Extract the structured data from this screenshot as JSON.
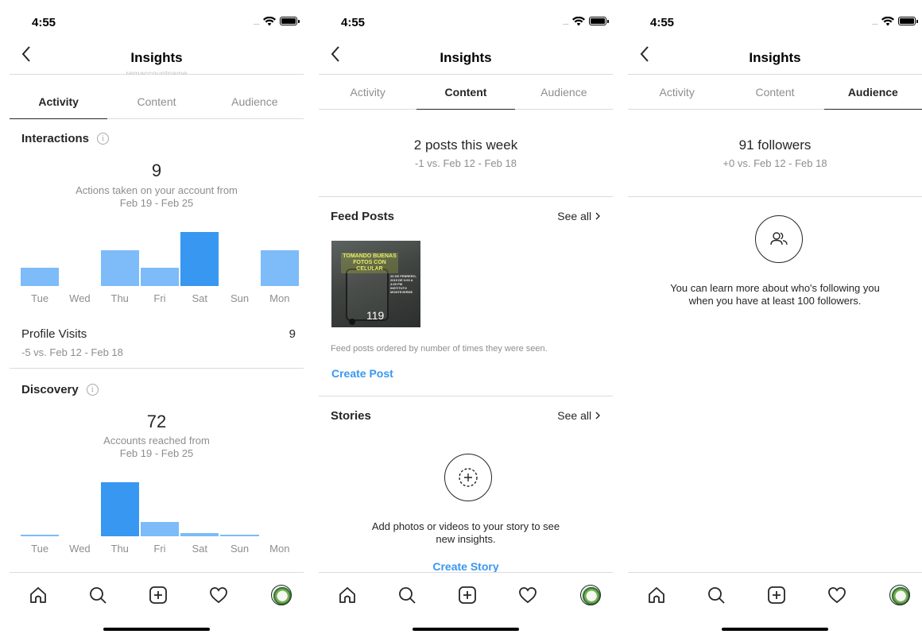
{
  "status": {
    "time": "4:55",
    "signal": "....."
  },
  "nav": {
    "title": "Insights",
    "hint": "remaccountname"
  },
  "tabs": [
    "Activity",
    "Content",
    "Audience"
  ],
  "activity": {
    "interactions": {
      "title": "Interactions",
      "info": "i",
      "count": "9",
      "caption": "Actions taken on your account from",
      "range": "Feb 19 - Feb 25",
      "days": [
        "Tue",
        "Wed",
        "Thu",
        "Fri",
        "Sat",
        "Sun",
        "Mon"
      ],
      "values": [
        1,
        0,
        2,
        1,
        3,
        0,
        2
      ],
      "highlight_index": 4
    },
    "profile_visits": {
      "label": "Profile Visits",
      "value": "9",
      "compare": "-5 vs. Feb 12 - Feb 18"
    },
    "discovery": {
      "title": "Discovery",
      "info": "i",
      "count": "72",
      "caption": "Accounts reached from",
      "range": "Feb 19 - Feb 25",
      "days": [
        "Tue",
        "Wed",
        "Thu",
        "Fri",
        "Sat",
        "Sun",
        "Mon"
      ],
      "values": [
        1,
        0,
        58,
        15,
        3,
        1,
        0
      ],
      "highlight_index": 2
    }
  },
  "content": {
    "summary": "2 posts this week",
    "compare": "-1 vs. Feb 12 - Feb 18",
    "feed": {
      "title": "Feed Posts",
      "see_all": "See all",
      "post_title": "TOMANDO BUENAS FOTOS CON CELULAR",
      "post_side": "20 DE FEBRERO, 2019 DE 3:00 A 4:00 PM INSTITUTO MONTEVERDE",
      "post_count": "119",
      "note": "Feed posts ordered by number of times they were seen.",
      "cta": "Create Post"
    },
    "stories": {
      "title": "Stories",
      "see_all": "See all",
      "empty_line1": "Add photos or videos to your story to see",
      "empty_line2": "new insights.",
      "cta": "Create Story"
    }
  },
  "audience": {
    "followers": "91 followers",
    "compare": "+0 vs. Feb 12 - Feb 18",
    "message_line1": "You can learn more about who's following you",
    "message_line2": "when you have at least 100 followers."
  },
  "icons": {
    "back": "chevron-left-icon",
    "wifi": "wifi-icon",
    "battery": "battery-icon",
    "info": "info-icon",
    "chevron": "chevron-right-icon",
    "home": "home-icon",
    "search": "search-icon",
    "add": "add-square-icon",
    "heart": "heart-icon",
    "profile": "avatar",
    "people": "people-icon",
    "story_add": "story-add-icon"
  },
  "colors": {
    "bar_light": "#7dbbf9",
    "bar_dark": "#3897f0",
    "link": "#3897f0",
    "text": "#262626",
    "muted": "#8e8e8e"
  }
}
